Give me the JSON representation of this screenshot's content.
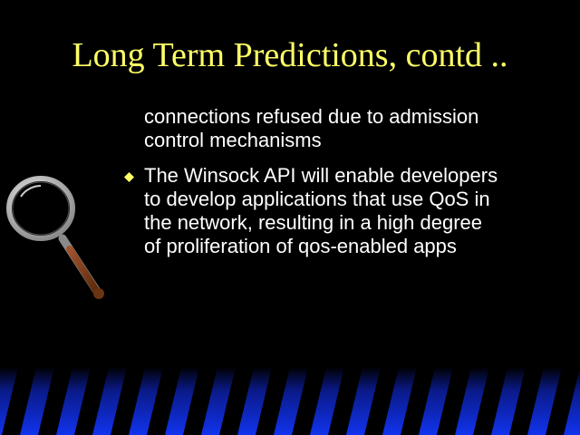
{
  "slide": {
    "title": "Long Term Predictions, contd ..",
    "continued_paragraph": {
      "lines": [
        "connections refused due to admission",
        "control mechanisms"
      ]
    },
    "bullets": [
      {
        "lines": [
          "The Winsock API will enable developers",
          "to develop applications that use QoS in",
          "the network, resulting in a high degree",
          "of proliferation of qos-enabled apps"
        ]
      }
    ]
  },
  "colors": {
    "background": "#000000",
    "title": "#ffff66",
    "body_text": "#ffffff",
    "bullet": "#ffff66",
    "stripe_blue": "#1133ee",
    "stripe_dark": "#000000"
  },
  "icons": {
    "bullet": "diamond-bullet-icon",
    "decoration": "magnifying-glass-icon"
  }
}
